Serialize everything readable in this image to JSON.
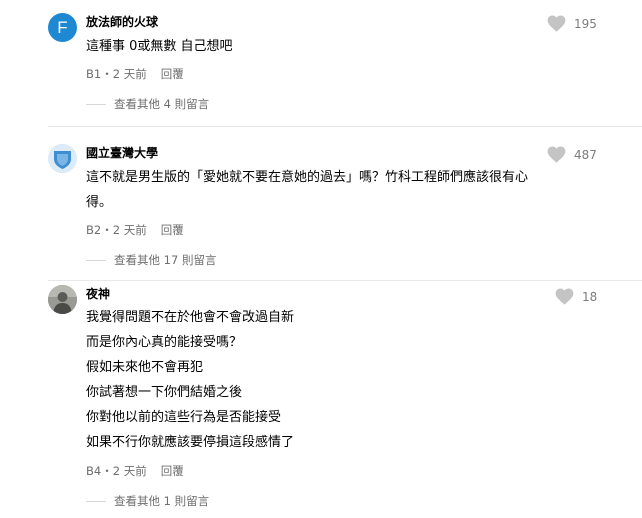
{
  "comments": [
    {
      "avatar_letter": "F",
      "author": "放法師的火球",
      "likes": "195",
      "lines": [
        "這種事 0或無數 自己想吧"
      ],
      "floor": "B1",
      "time": "2 天前",
      "reply_label": "回覆",
      "more_replies": "查看其他 4 則留言"
    },
    {
      "author": "國立臺灣大學",
      "likes": "487",
      "lines": [
        "這不就是男生版的「愛她就不要在意她的過去」嗎？竹科工程師們應該很有心",
        "得。"
      ],
      "floor": "B2",
      "time": "2 天前",
      "reply_label": "回覆",
      "more_replies": "查看其他 17 則留言"
    },
    {
      "author": "夜神",
      "likes": "18",
      "lines": [
        "我覺得問題不在於他會不會改過自新",
        "而是你內心真的能接受嗎？",
        "假如未來他不會再犯",
        "你試著想一下你們結婚之後",
        "你對他以前的這些行為是否能接受",
        "如果不行你就應該要停損這段感情了"
      ],
      "floor": "B4",
      "time": "2 天前",
      "reply_label": "回覆",
      "more_replies": "查看其他 1 則留言"
    }
  ],
  "meta_separator": "・",
  "icons": {
    "like": "heart-icon"
  },
  "colors": {
    "avatar_f": "#1e88d2",
    "heart": "#c4c4c4",
    "meta": "#6e6e6e"
  }
}
